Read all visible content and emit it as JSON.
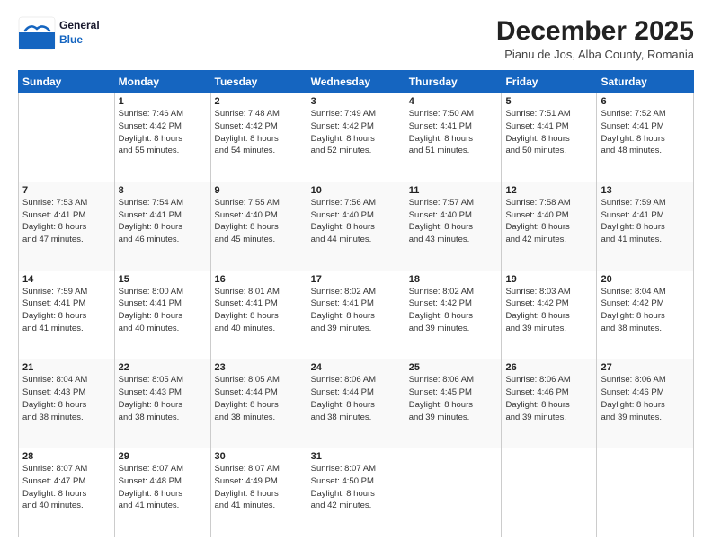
{
  "logo": {
    "line1": "General",
    "line2": "Blue"
  },
  "header": {
    "title": "December 2025",
    "subtitle": "Pianu de Jos, Alba County, Romania"
  },
  "weekdays": [
    "Sunday",
    "Monday",
    "Tuesday",
    "Wednesday",
    "Thursday",
    "Friday",
    "Saturday"
  ],
  "weeks": [
    [
      {
        "day": "",
        "info": ""
      },
      {
        "day": "1",
        "info": "Sunrise: 7:46 AM\nSunset: 4:42 PM\nDaylight: 8 hours\nand 55 minutes."
      },
      {
        "day": "2",
        "info": "Sunrise: 7:48 AM\nSunset: 4:42 PM\nDaylight: 8 hours\nand 54 minutes."
      },
      {
        "day": "3",
        "info": "Sunrise: 7:49 AM\nSunset: 4:42 PM\nDaylight: 8 hours\nand 52 minutes."
      },
      {
        "day": "4",
        "info": "Sunrise: 7:50 AM\nSunset: 4:41 PM\nDaylight: 8 hours\nand 51 minutes."
      },
      {
        "day": "5",
        "info": "Sunrise: 7:51 AM\nSunset: 4:41 PM\nDaylight: 8 hours\nand 50 minutes."
      },
      {
        "day": "6",
        "info": "Sunrise: 7:52 AM\nSunset: 4:41 PM\nDaylight: 8 hours\nand 48 minutes."
      }
    ],
    [
      {
        "day": "7",
        "info": "Sunrise: 7:53 AM\nSunset: 4:41 PM\nDaylight: 8 hours\nand 47 minutes."
      },
      {
        "day": "8",
        "info": "Sunrise: 7:54 AM\nSunset: 4:41 PM\nDaylight: 8 hours\nand 46 minutes."
      },
      {
        "day": "9",
        "info": "Sunrise: 7:55 AM\nSunset: 4:40 PM\nDaylight: 8 hours\nand 45 minutes."
      },
      {
        "day": "10",
        "info": "Sunrise: 7:56 AM\nSunset: 4:40 PM\nDaylight: 8 hours\nand 44 minutes."
      },
      {
        "day": "11",
        "info": "Sunrise: 7:57 AM\nSunset: 4:40 PM\nDaylight: 8 hours\nand 43 minutes."
      },
      {
        "day": "12",
        "info": "Sunrise: 7:58 AM\nSunset: 4:40 PM\nDaylight: 8 hours\nand 42 minutes."
      },
      {
        "day": "13",
        "info": "Sunrise: 7:59 AM\nSunset: 4:41 PM\nDaylight: 8 hours\nand 41 minutes."
      }
    ],
    [
      {
        "day": "14",
        "info": "Sunrise: 7:59 AM\nSunset: 4:41 PM\nDaylight: 8 hours\nand 41 minutes."
      },
      {
        "day": "15",
        "info": "Sunrise: 8:00 AM\nSunset: 4:41 PM\nDaylight: 8 hours\nand 40 minutes."
      },
      {
        "day": "16",
        "info": "Sunrise: 8:01 AM\nSunset: 4:41 PM\nDaylight: 8 hours\nand 40 minutes."
      },
      {
        "day": "17",
        "info": "Sunrise: 8:02 AM\nSunset: 4:41 PM\nDaylight: 8 hours\nand 39 minutes."
      },
      {
        "day": "18",
        "info": "Sunrise: 8:02 AM\nSunset: 4:42 PM\nDaylight: 8 hours\nand 39 minutes."
      },
      {
        "day": "19",
        "info": "Sunrise: 8:03 AM\nSunset: 4:42 PM\nDaylight: 8 hours\nand 39 minutes."
      },
      {
        "day": "20",
        "info": "Sunrise: 8:04 AM\nSunset: 4:42 PM\nDaylight: 8 hours\nand 38 minutes."
      }
    ],
    [
      {
        "day": "21",
        "info": "Sunrise: 8:04 AM\nSunset: 4:43 PM\nDaylight: 8 hours\nand 38 minutes."
      },
      {
        "day": "22",
        "info": "Sunrise: 8:05 AM\nSunset: 4:43 PM\nDaylight: 8 hours\nand 38 minutes."
      },
      {
        "day": "23",
        "info": "Sunrise: 8:05 AM\nSunset: 4:44 PM\nDaylight: 8 hours\nand 38 minutes."
      },
      {
        "day": "24",
        "info": "Sunrise: 8:06 AM\nSunset: 4:44 PM\nDaylight: 8 hours\nand 38 minutes."
      },
      {
        "day": "25",
        "info": "Sunrise: 8:06 AM\nSunset: 4:45 PM\nDaylight: 8 hours\nand 39 minutes."
      },
      {
        "day": "26",
        "info": "Sunrise: 8:06 AM\nSunset: 4:46 PM\nDaylight: 8 hours\nand 39 minutes."
      },
      {
        "day": "27",
        "info": "Sunrise: 8:06 AM\nSunset: 4:46 PM\nDaylight: 8 hours\nand 39 minutes."
      }
    ],
    [
      {
        "day": "28",
        "info": "Sunrise: 8:07 AM\nSunset: 4:47 PM\nDaylight: 8 hours\nand 40 minutes."
      },
      {
        "day": "29",
        "info": "Sunrise: 8:07 AM\nSunset: 4:48 PM\nDaylight: 8 hours\nand 41 minutes."
      },
      {
        "day": "30",
        "info": "Sunrise: 8:07 AM\nSunset: 4:49 PM\nDaylight: 8 hours\nand 41 minutes."
      },
      {
        "day": "31",
        "info": "Sunrise: 8:07 AM\nSunset: 4:50 PM\nDaylight: 8 hours\nand 42 minutes."
      },
      {
        "day": "",
        "info": ""
      },
      {
        "day": "",
        "info": ""
      },
      {
        "day": "",
        "info": ""
      }
    ]
  ]
}
